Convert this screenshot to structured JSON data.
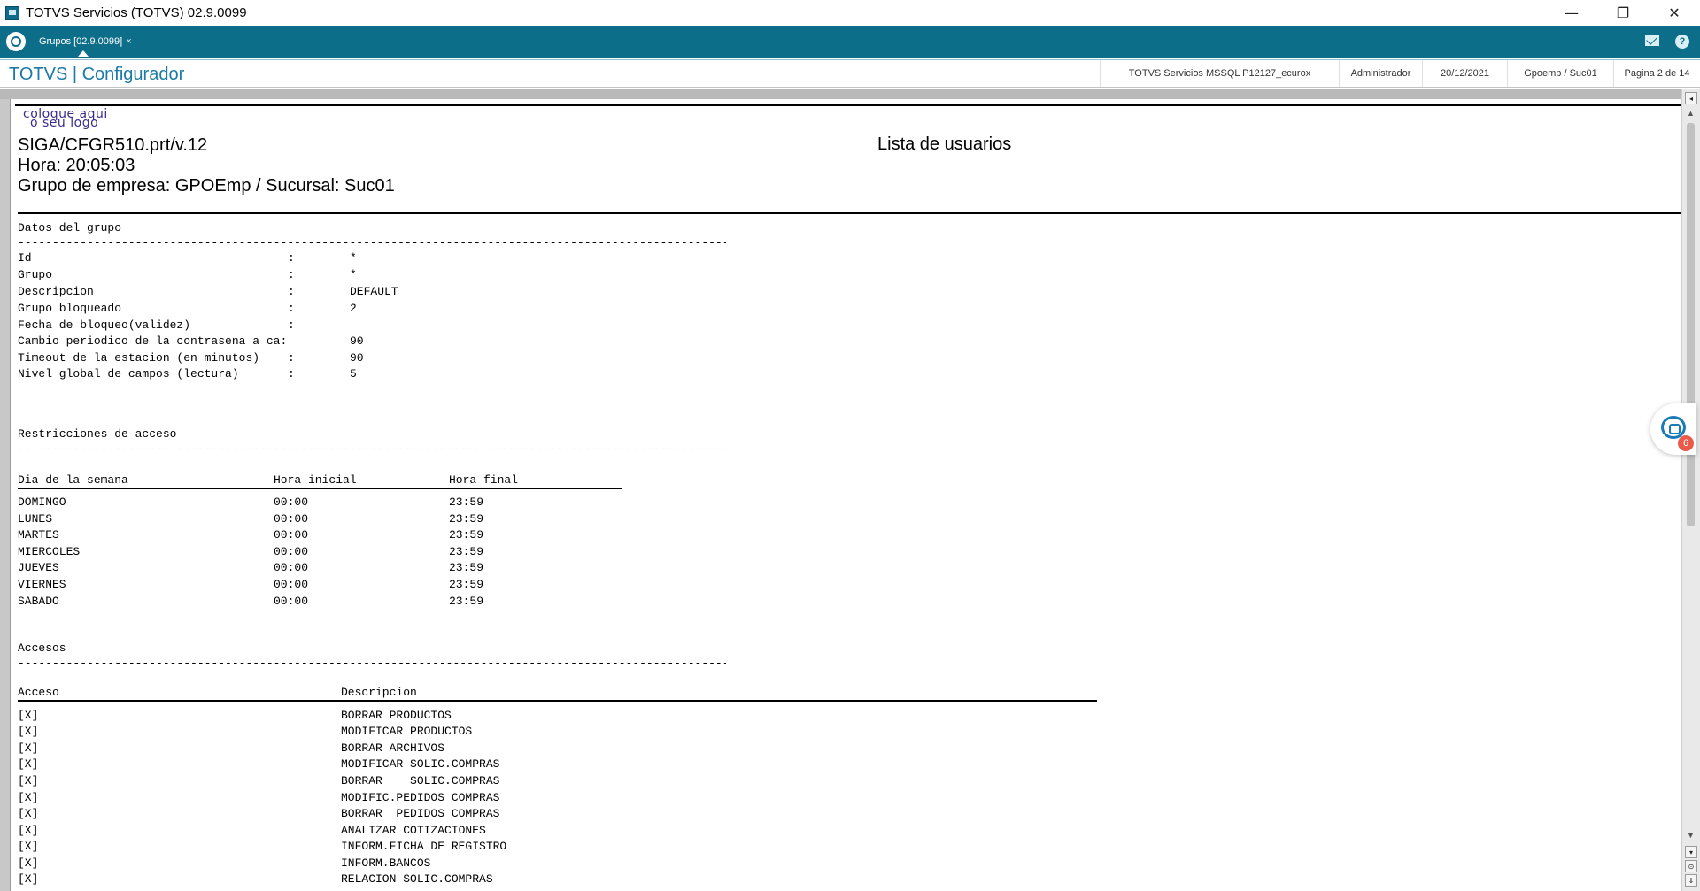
{
  "window": {
    "title": "TOTVS Servicios (TOTVS) 02.9.0099",
    "minimize": "—",
    "restore": "❐",
    "close": "✕"
  },
  "tabs": [
    {
      "label": "Grupos [02.9.0099]",
      "close": "×"
    }
  ],
  "header": {
    "brand": "TOTVS | Configurador",
    "environment": "TOTVS Servicios MSSQL P12127_ecurox",
    "user": "Administrador",
    "date": "20/12/2021",
    "company": "Gpoemp / Suc01",
    "page": "Pagina 2 de 14"
  },
  "report": {
    "logo_line1": "coloque aqui",
    "logo_line2": "o seu logo",
    "program": "SIGA/CFGR510.prt/v.12",
    "time": "Hora: 20:05:03",
    "group_branch": "Grupo de empresa: GPOEmp / Sucursal: Suc01",
    "title": "Lista de usuarios",
    "dashes": "-------------------------------------------------------------------------------------------------------------------",
    "group_section": {
      "title": "Datos del grupo",
      "rows": [
        {
          "label": "Id",
          "sep": ":",
          "value": "*"
        },
        {
          "label": "Grupo",
          "sep": ":",
          "value": "*"
        },
        {
          "label": "Descripcion",
          "sep": ":",
          "value": "DEFAULT"
        },
        {
          "label": "Grupo bloqueado",
          "sep": ":",
          "value": "2"
        },
        {
          "label": "Fecha de bloqueo(validez)",
          "sep": ":",
          "value": ""
        },
        {
          "label": "Cambio periodico de la contrasena a ca:",
          "sep": "",
          "value": "90"
        },
        {
          "label": "Timeout de la estacion (en minutos)",
          "sep": ":",
          "value": "90"
        },
        {
          "label": "Nivel global de campos (lectura)",
          "sep": ":",
          "value": "5"
        }
      ]
    },
    "restrictions_section": {
      "title": "Restricciones de acceso",
      "headers": [
        "Dia de la semana",
        "Hora inicial",
        "Hora final"
      ],
      "rows": [
        [
          "DOMINGO",
          "00:00",
          "23:59"
        ],
        [
          "LUNES",
          "00:00",
          "23:59"
        ],
        [
          "MARTES",
          "00:00",
          "23:59"
        ],
        [
          "MIERCOLES",
          "00:00",
          "23:59"
        ],
        [
          "JUEVES",
          "00:00",
          "23:59"
        ],
        [
          "VIERNES",
          "00:00",
          "23:59"
        ],
        [
          "SABADO",
          "00:00",
          "23:59"
        ]
      ]
    },
    "access_section": {
      "title": "Accesos",
      "headers": [
        "Acceso",
        "Descripcion"
      ],
      "rows": [
        [
          "[X]",
          "BORRAR PRODUCTOS"
        ],
        [
          "[X]",
          "MODIFICAR PRODUCTOS"
        ],
        [
          "[X]",
          "BORRAR ARCHIVOS"
        ],
        [
          "[X]",
          "MODIFICAR SOLIC.COMPRAS"
        ],
        [
          "[X]",
          "BORRAR    SOLIC.COMPRAS"
        ],
        [
          "[X]",
          "MODIFIC.PEDIDOS COMPRAS"
        ],
        [
          "[X]",
          "BORRAR  PEDIDOS COMPRAS"
        ],
        [
          "[X]",
          "ANALIZAR COTIZACIONES"
        ],
        [
          "[X]",
          "INFORM.FICHA DE REGISTRO"
        ],
        [
          "[X]",
          "INFORM.BANCOS"
        ],
        [
          "[X]",
          "RELACION SOLIC.COMPRAS"
        ]
      ]
    }
  },
  "scrollbar": {
    "top_btn": "◂",
    "up_arrow": "▲",
    "down_arrow": "▼",
    "btn_down": "▾",
    "btn_zoom": "⊙",
    "btn_bottom": "⇓"
  },
  "chat": {
    "badge": "6"
  }
}
